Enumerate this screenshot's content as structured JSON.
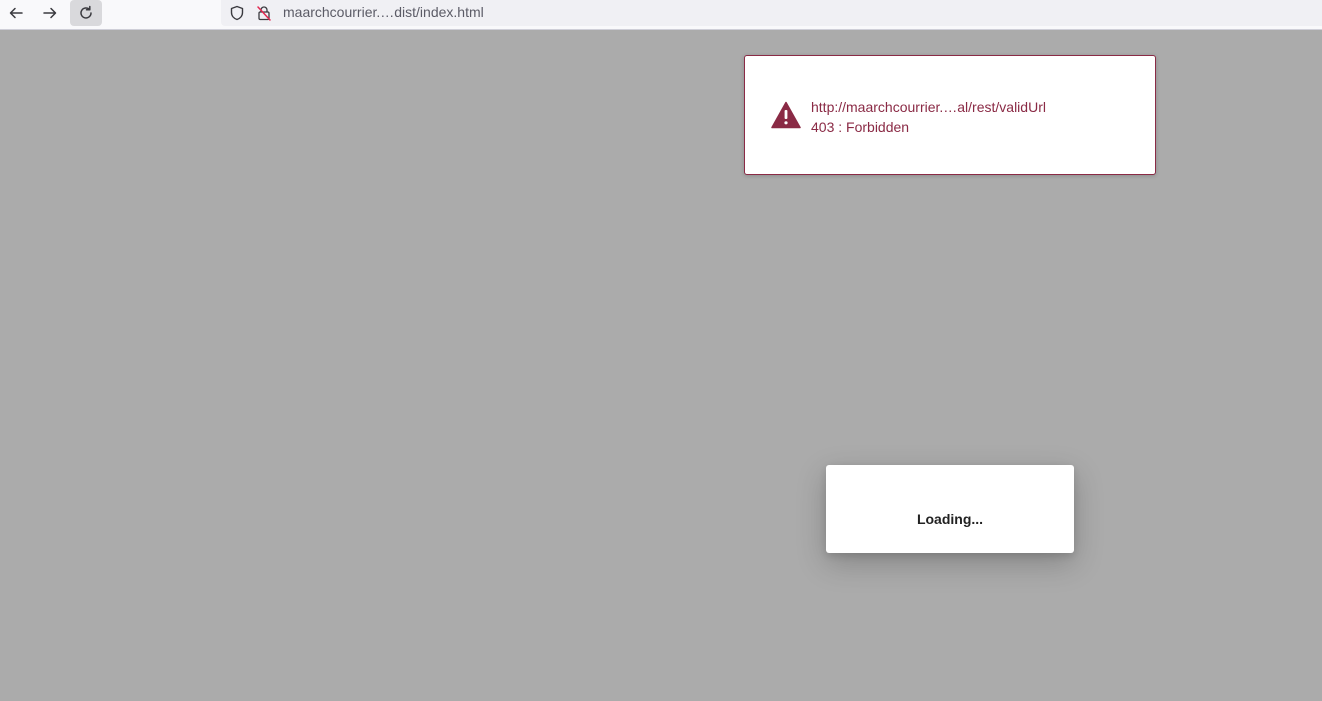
{
  "browser": {
    "back_icon": "arrow-left-icon",
    "forward_icon": "arrow-right-icon",
    "reload_icon": "reload-icon",
    "shield_icon": "shield-icon",
    "lock_icon": "insecure-lock-icon",
    "url": "maarchcourrier.…dist/index.html"
  },
  "error_toast": {
    "icon": "warning-triangle-icon",
    "url_line": "http://maarchcourrier.…al/rest/validUrl",
    "status_line": "403 : Forbidden",
    "color": "#8a2a45"
  },
  "loading_dialog": {
    "text": "Loading..."
  },
  "colors": {
    "backdrop": "#ababab",
    "error_accent": "#8a2a45"
  }
}
